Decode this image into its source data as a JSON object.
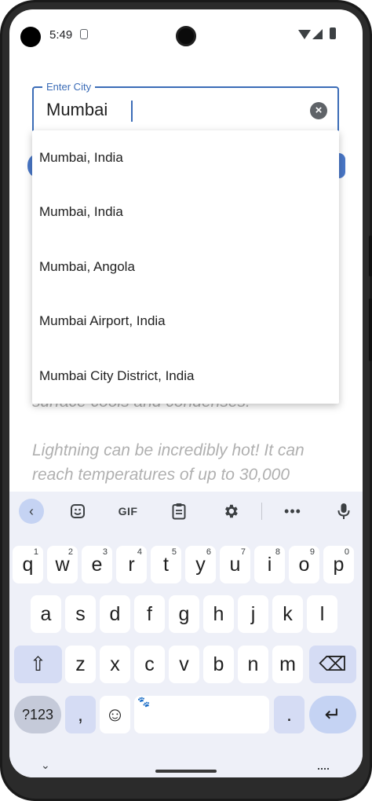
{
  "status_bar": {
    "time": "5:49"
  },
  "field": {
    "label": "Enter City",
    "value": "Mumbai",
    "clear_glyph": "×"
  },
  "suggestions": [
    "Mumbai, India",
    "Mumbai, India",
    "Mumbai, Angola",
    "Mumbai Airport, India",
    "Mumbai City District, India"
  ],
  "background_text": {
    "line1": "surface cools and condenses.",
    "para2": "Lightning can be incredibly hot! It can reach temperatures of up to 30,000"
  },
  "keyboard": {
    "toolbar": {
      "back": "‹",
      "gif": "GIF",
      "more": "•••"
    },
    "row1": [
      {
        "k": "q",
        "h": "1"
      },
      {
        "k": "w",
        "h": "2"
      },
      {
        "k": "e",
        "h": "3"
      },
      {
        "k": "r",
        "h": "4"
      },
      {
        "k": "t",
        "h": "5"
      },
      {
        "k": "y",
        "h": "6"
      },
      {
        "k": "u",
        "h": "7"
      },
      {
        "k": "i",
        "h": "8"
      },
      {
        "k": "o",
        "h": "9"
      },
      {
        "k": "p",
        "h": "0"
      }
    ],
    "row2": [
      "a",
      "s",
      "d",
      "f",
      "g",
      "h",
      "j",
      "k",
      "l"
    ],
    "row3": [
      "z",
      "x",
      "c",
      "v",
      "b",
      "n",
      "m"
    ],
    "sym_label": "?123",
    "comma": ",",
    "period": ".",
    "emoji": "☺",
    "space_icon": "🐾",
    "shift_glyph": "⇧",
    "backspace_glyph": "⌫",
    "enter_glyph": "↵"
  },
  "nav": {
    "down_glyph": "⌄"
  },
  "colors": {
    "accent": "#3b6cb7",
    "keyboard_bg": "#eef0f8"
  }
}
